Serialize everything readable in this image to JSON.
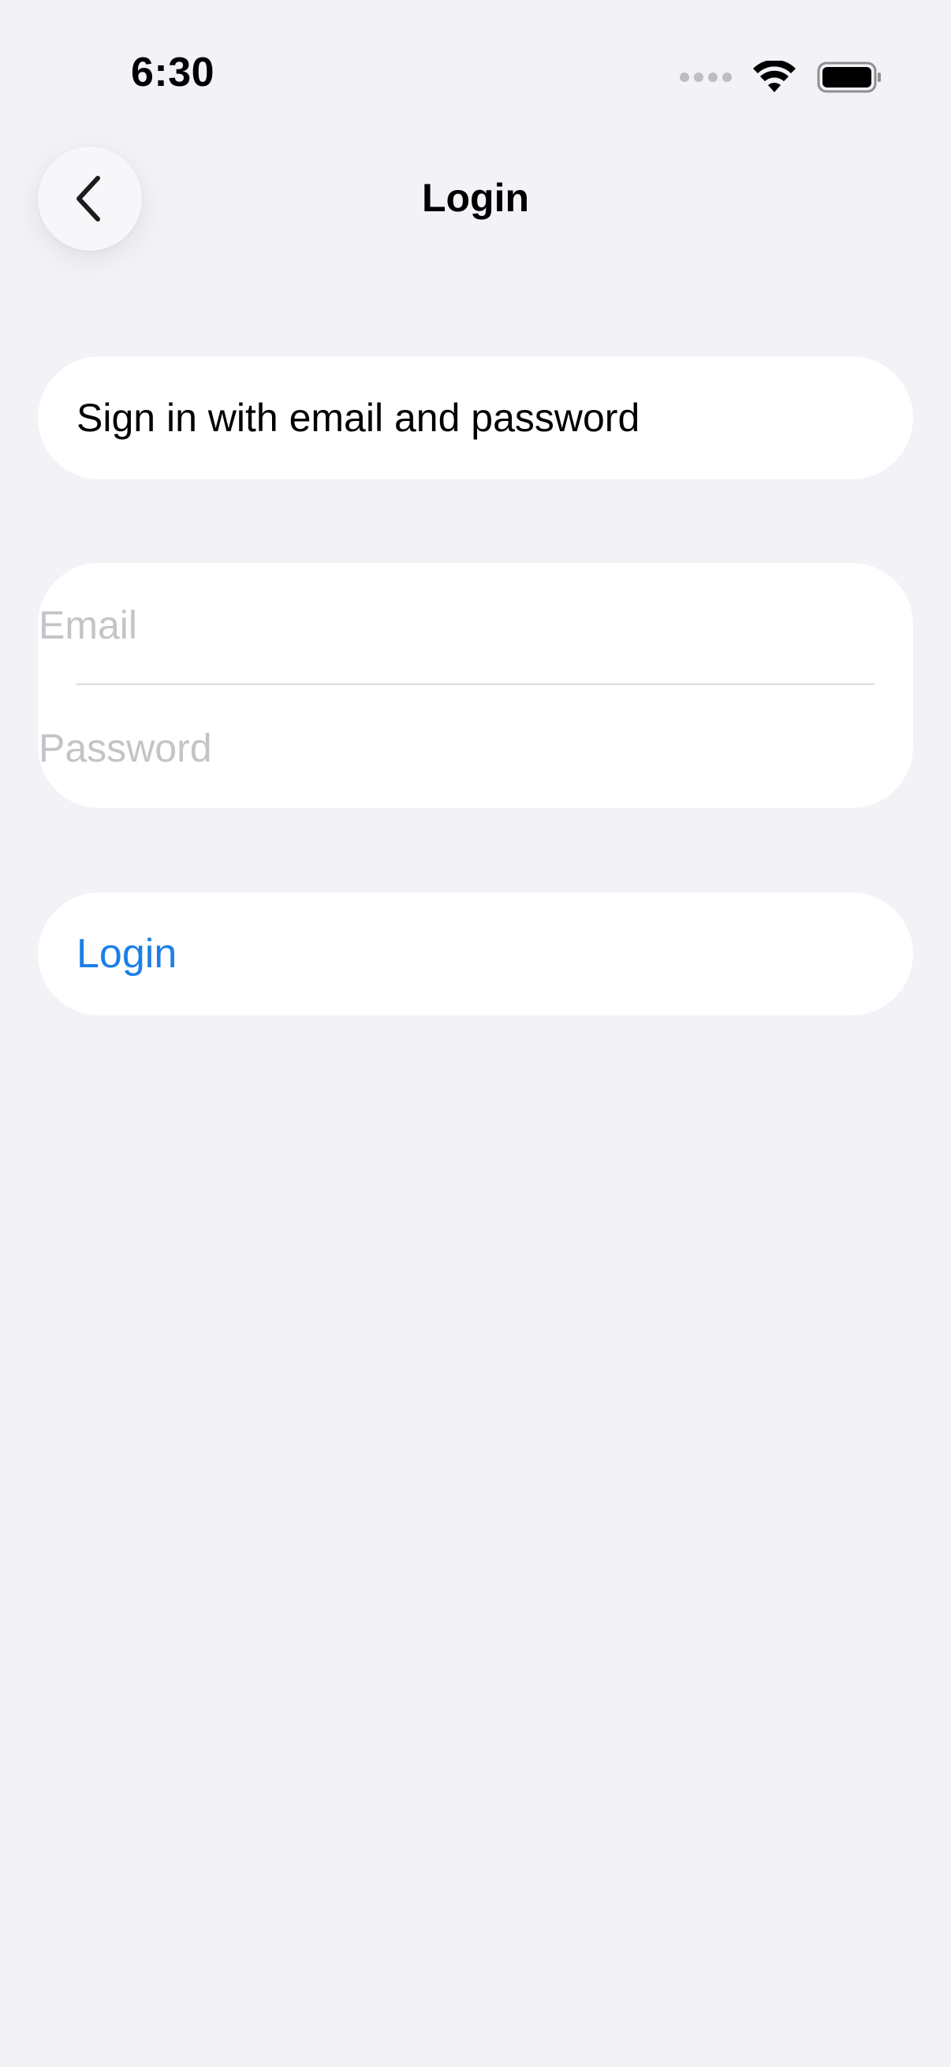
{
  "status_bar": {
    "time": "6:30",
    "icons": [
      "cellular-signal-icon",
      "wifi-icon",
      "battery-icon"
    ]
  },
  "nav": {
    "title": "Login",
    "back_icon": "chevron-left-icon"
  },
  "info_card": {
    "text": "Sign in with email and password"
  },
  "form": {
    "email_placeholder": "Email",
    "password_placeholder": "Password"
  },
  "login_button": {
    "label": "Login"
  },
  "colors": {
    "background": "#F2F2F7",
    "card": "#FFFFFF",
    "accent": "#1C7FE6",
    "placeholder": "#C4C4C7"
  }
}
